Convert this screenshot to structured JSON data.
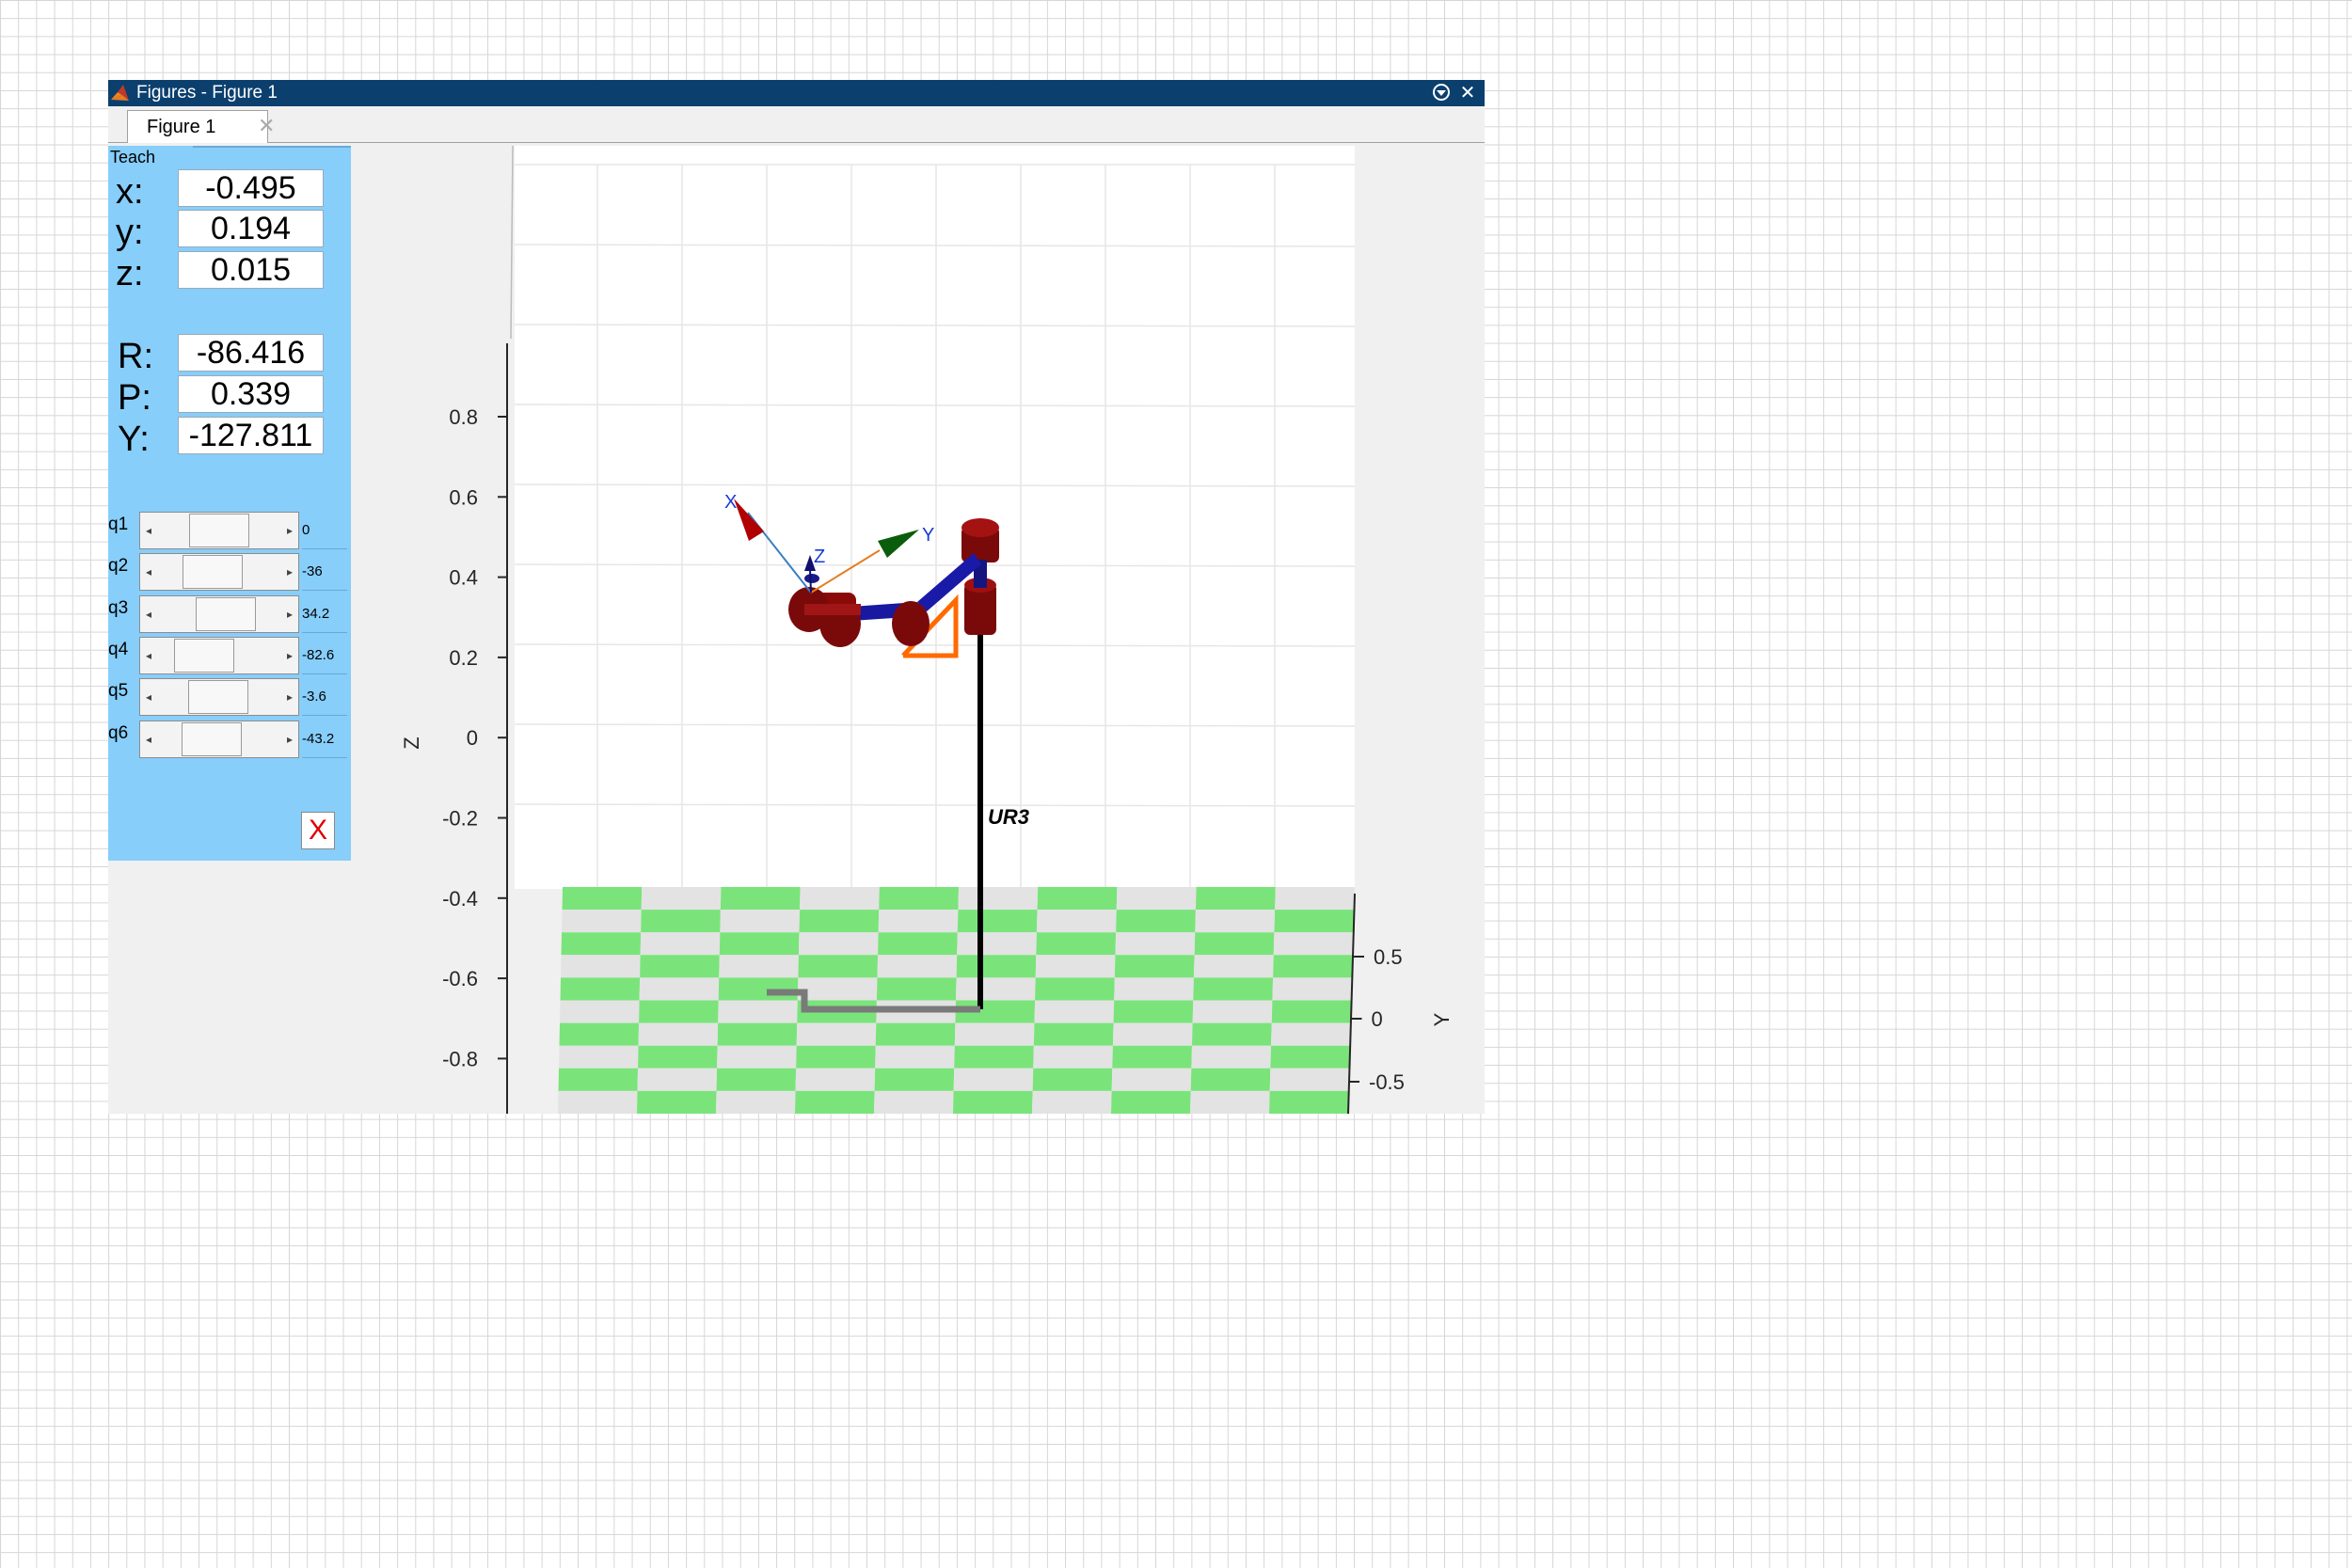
{
  "window": {
    "title": "Figures - Figure 1",
    "tab_label": "Figure 1"
  },
  "teach": {
    "panel_title": "Teach",
    "position": [
      {
        "label": "x:",
        "value": "-0.495"
      },
      {
        "label": "y:",
        "value": "0.194"
      },
      {
        "label": "z:",
        "value": "0.015"
      }
    ],
    "orientation": [
      {
        "label": "R:",
        "value": "-86.416"
      },
      {
        "label": "P:",
        "value": "0.339"
      },
      {
        "label": "Y:",
        "value": "-127.811"
      }
    ],
    "joints": [
      {
        "label": "q1",
        "value": "0",
        "slider_fraction": 0.5
      },
      {
        "label": "q2",
        "value": "-36",
        "slider_fraction": 0.4
      },
      {
        "label": "q3",
        "value": "34.2",
        "slider_fraction": 0.6
      },
      {
        "label": "q4",
        "value": "-82.6",
        "slider_fraction": 0.27
      },
      {
        "label": "q5",
        "value": "-3.6",
        "slider_fraction": 0.49
      },
      {
        "label": "q6",
        "value": "-43.2",
        "slider_fraction": 0.38
      }
    ],
    "close_label": "X"
  },
  "plot": {
    "robot_name": "UR3",
    "z_axis_label": "Z",
    "y_axis_label": "Y",
    "z_ticks": [
      "0.8",
      "0.6",
      "0.4",
      "0.2",
      "0",
      "-0.2",
      "-0.4",
      "-0.6",
      "-0.8"
    ],
    "y_ticks": [
      "0.5",
      "0",
      "-0.5"
    ],
    "frame_labels": {
      "x": "X",
      "y": "Y",
      "z": "Z"
    },
    "colors": {
      "floor_green": "#7ae47a",
      "floor_gray": "#e3e3e3",
      "link_red": "#8b0000",
      "link_blue": "#1a1aa8",
      "gripper_orange": "#ff6a00",
      "frame_x": "#c00000",
      "frame_y": "#0a5d0a",
      "frame_z": "#10106f"
    }
  }
}
